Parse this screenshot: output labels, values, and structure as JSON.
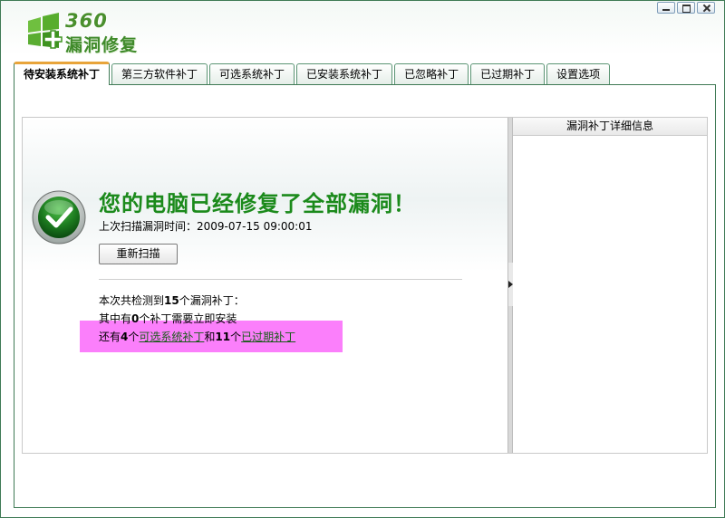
{
  "app": {
    "logo_number": "360",
    "logo_name": "漏洞修复"
  },
  "window_controls": [
    "minimize",
    "maximize",
    "close"
  ],
  "tabs": [
    {
      "label": "待安装系统补丁",
      "active": true
    },
    {
      "label": "第三方软件补丁",
      "active": false
    },
    {
      "label": "可选系统补丁",
      "active": false
    },
    {
      "label": "已安装系统补丁",
      "active": false
    },
    {
      "label": "已忽略补丁",
      "active": false
    },
    {
      "label": "已过期补丁",
      "active": false
    },
    {
      "label": "设置选项",
      "active": false
    }
  ],
  "main": {
    "status_title": "您的电脑已经修复了全部漏洞！",
    "last_scan_label": "上次扫描漏洞时间：",
    "last_scan_time": "2009-07-15 09:00:01",
    "rescan_button": "重新扫描",
    "summary": {
      "line1_prefix": "本次共检测到",
      "total": "15",
      "line1_suffix": "个漏洞补丁：",
      "line2_prefix": "其中有",
      "urgent": "0",
      "line2_suffix": "个补丁需要立即安装",
      "line3_prefix": "还有",
      "optional": "4",
      "line3_unit": "个",
      "optional_link": "可选系统补丁",
      "line3_and": "和",
      "expired": "11",
      "line3_unit2": "个",
      "expired_link": "已过期补丁"
    }
  },
  "detail_panel": {
    "header": "漏洞补丁详细信息"
  },
  "colors": {
    "accent_green": "#1b8a1b",
    "frame_green": "#3f7a55",
    "tab_active_top": "#e8a43a",
    "highlight": "#fb7ffb"
  },
  "icons": {
    "status": "check-icon",
    "splitter": "triangle-right-icon"
  }
}
